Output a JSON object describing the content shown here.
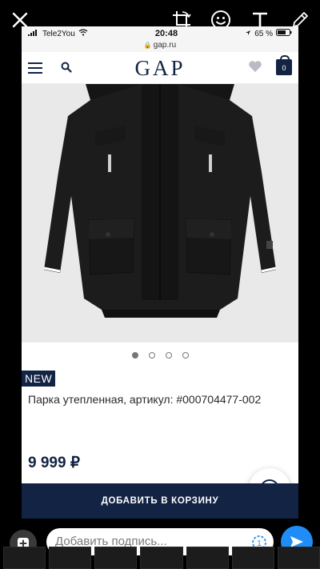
{
  "status_bar": {
    "carrier": "Tele2You",
    "time": "20:48",
    "battery": "65 %"
  },
  "url_bar": {
    "domain": "gap.ru"
  },
  "header": {
    "logo": "GAP",
    "cart_count": "0"
  },
  "product": {
    "badge": "NEW",
    "title": "Парка утепленная, артикул: #000704477-002",
    "price": "9 999 ₽",
    "add_to_cart_label": "ДОБАВИТЬ В КОРЗИНУ",
    "carousel": {
      "total": 4,
      "active": 1
    }
  },
  "caption": {
    "placeholder": "Добавить подпись..."
  },
  "colors": {
    "brand_navy": "#122344",
    "send_blue": "#1f8df5",
    "image_background": "#e9e9e9"
  },
  "icons": {
    "close": "close-icon",
    "crop": "crop-rotate-icon",
    "sticker": "sticker-icon",
    "text": "text-icon",
    "draw": "pencil-icon",
    "menu": "menu-icon",
    "search": "search-icon",
    "wishlist": "heart-icon",
    "cart": "shopping-bag-icon",
    "chat": "chat-icon",
    "add": "add-media-icon",
    "timer": "timer-icon",
    "send": "send-icon"
  }
}
